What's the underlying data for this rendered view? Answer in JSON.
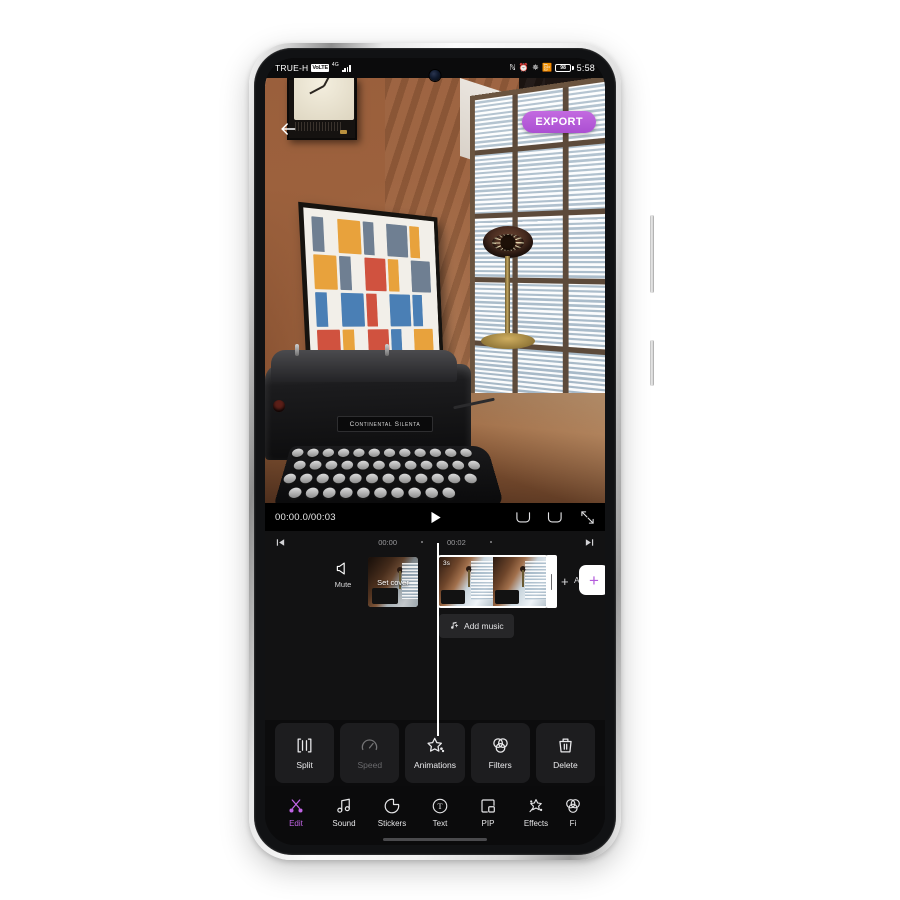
{
  "status_bar": {
    "carrier": "TRUE-H",
    "network_badge": "VoLTE",
    "network_type": "4G",
    "signal_label": "signal-bars",
    "icons": [
      "nfc-icon",
      "alarm-icon",
      "bluetooth-icon",
      "vibrate-icon"
    ],
    "battery_level": "98",
    "time": "5:58"
  },
  "header": {
    "back_label": "back-arrow",
    "export_label": "EXPORT",
    "export_color": "#b455d6"
  },
  "preview": {
    "scene_description": "Vintage typewriter on wooden table in a sunlit room",
    "typewriter_nameplate": "Continental Silenta"
  },
  "transport": {
    "time_display": "00:00.0/00:03",
    "current_time": "00:00.0",
    "total_time": "00:03",
    "play_label": "play-button",
    "undo_label": "undo-button",
    "redo_label": "redo-button",
    "fullscreen_label": "fullscreen-button"
  },
  "ruler": {
    "skip_start": "skip-to-start",
    "skip_end": "skip-to-end",
    "ticks": [
      "00:00",
      "00:02"
    ]
  },
  "timeline": {
    "mute_label": "Mute",
    "set_cover_label": "Set cover",
    "clip_duration": "3s",
    "add_clip_text": "Add pro",
    "add_clip_plus": "+",
    "add_music_label": "Add music",
    "add_button_glyph": "+"
  },
  "tools": [
    {
      "label": "Split",
      "icon": "split-icon",
      "disabled": false
    },
    {
      "label": "Speed",
      "icon": "speed-icon",
      "disabled": true
    },
    {
      "label": "Animations",
      "icon": "animations-icon",
      "disabled": false
    },
    {
      "label": "Filters",
      "icon": "filters-icon",
      "disabled": false
    },
    {
      "label": "Delete",
      "icon": "delete-icon",
      "disabled": false
    }
  ],
  "bottom_nav": {
    "active_color": "#c064e4",
    "items": [
      {
        "label": "Edit",
        "icon": "scissors-icon",
        "active": true
      },
      {
        "label": "Sound",
        "icon": "music-note-icon",
        "active": false
      },
      {
        "label": "Stickers",
        "icon": "sticker-icon",
        "active": false
      },
      {
        "label": "Text",
        "icon": "text-icon",
        "active": false
      },
      {
        "label": "PIP",
        "icon": "pip-icon",
        "active": false
      },
      {
        "label": "Effects",
        "icon": "effects-icon",
        "active": false
      },
      {
        "label": "Fi",
        "icon": "filters-icon",
        "active": false
      }
    ]
  }
}
